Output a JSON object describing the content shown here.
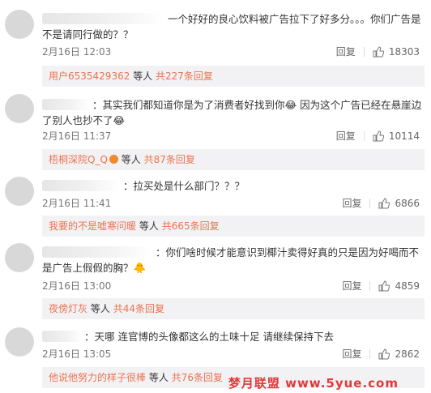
{
  "comments": [
    {
      "text": "一个好好的良心饮料被广告拉下了好多分。。。你们广告是不是请同行做的？？",
      "time": "2月16日 12:03",
      "reply_label": "回复",
      "likes": "18303",
      "replies": {
        "user": "用户6535429362",
        "mid": "等人",
        "count": "共227条回复"
      }
    },
    {
      "text": "：其实我们都知道你是为了消费者好找到你😂 因为这个广告已经在悬崖边了别人也抄不了😂",
      "time": "2月16日 11:37",
      "reply_label": "回复",
      "likes": "10114",
      "replies": {
        "user": "梧桐深院Q_Q",
        "mid": "等人",
        "count": "共87条回复"
      }
    },
    {
      "text": "：拉买处是什么部门？？？",
      "time": "2月16日 11:41",
      "reply_label": "回复",
      "likes": "6866",
      "replies": {
        "user": "我要的不是嘘寒问暖",
        "mid": "等人",
        "count": "共665条回复"
      }
    },
    {
      "text": "：你们啥时候才能意识到椰汁卖得好真的只是因为好喝而不是广告上假假的胸？🐥",
      "time": "2月16日 13:00",
      "reply_label": "回复",
      "likes": "4859",
      "replies": {
        "user": "夜傍灯灰",
        "mid": "等人",
        "count": "共44条回复"
      }
    },
    {
      "text": "：天哪 连官博的头像都这么的土味十足 请继续保持下去",
      "time": "2月16日 13:05",
      "reply_label": "回复",
      "likes": "2862",
      "replies": {
        "user": "他说他努力的样子很棒",
        "mid": "等人",
        "count": "共76条回复"
      }
    }
  ],
  "watermark": "梦月联盟 www.5yue.com",
  "colors": {
    "accent": "#eb7350",
    "reply_bg": "#f2f2f5"
  }
}
